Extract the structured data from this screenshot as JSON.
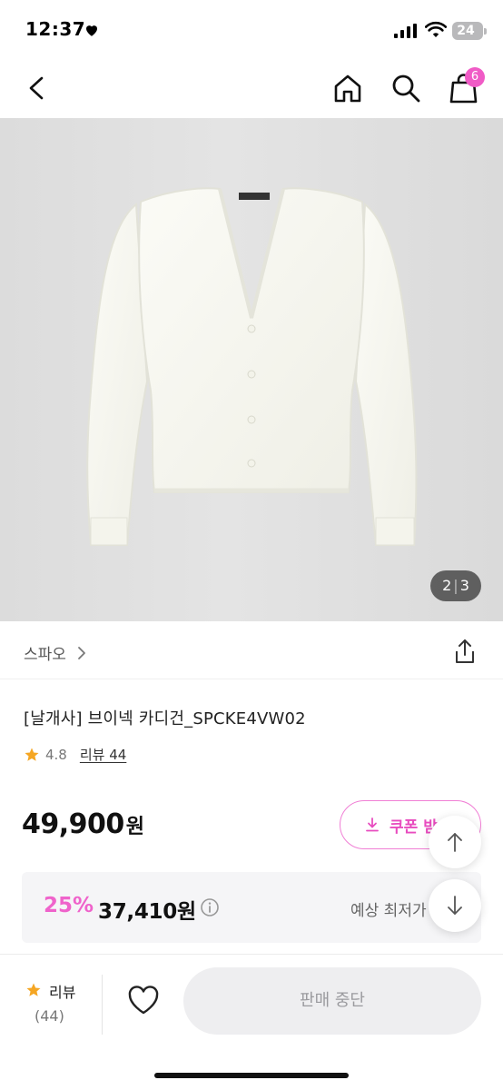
{
  "status_bar": {
    "time": "12:37",
    "battery": "24"
  },
  "nav": {
    "cart_count": "6"
  },
  "gallery": {
    "current": "2",
    "separator": "|",
    "total": "3"
  },
  "brand": {
    "name": "스파오"
  },
  "product": {
    "title": "[날개사] 브이넥 카디건_SPCKE4VW02",
    "rating": "4.8",
    "review_label": "리뷰 44"
  },
  "price": {
    "original": "49,900",
    "currency": "원",
    "coupon_label": "쿠폰 받"
  },
  "discount": {
    "rate": "25%",
    "price": "37,410원",
    "lowest_label": "예상 최저가"
  },
  "bottom_bar": {
    "review_label": "리뷰",
    "review_count": "(44)",
    "buy_label": "판매 중단"
  },
  "colors": {
    "accent": "#ef63cb",
    "badge": "#f05bc6",
    "star": "#f5a623",
    "disabled_button": "#eeeef0"
  },
  "icons": {
    "back": "chevron-left-icon",
    "home": "home-icon",
    "search": "search-icon",
    "cart": "shopping-bag-icon",
    "share": "share-icon",
    "star": "star-icon",
    "info": "info-icon",
    "download": "download-arrow-icon",
    "wish": "heart-icon",
    "scroll_up": "arrow-up-icon",
    "scroll_down": "arrow-down-icon"
  }
}
